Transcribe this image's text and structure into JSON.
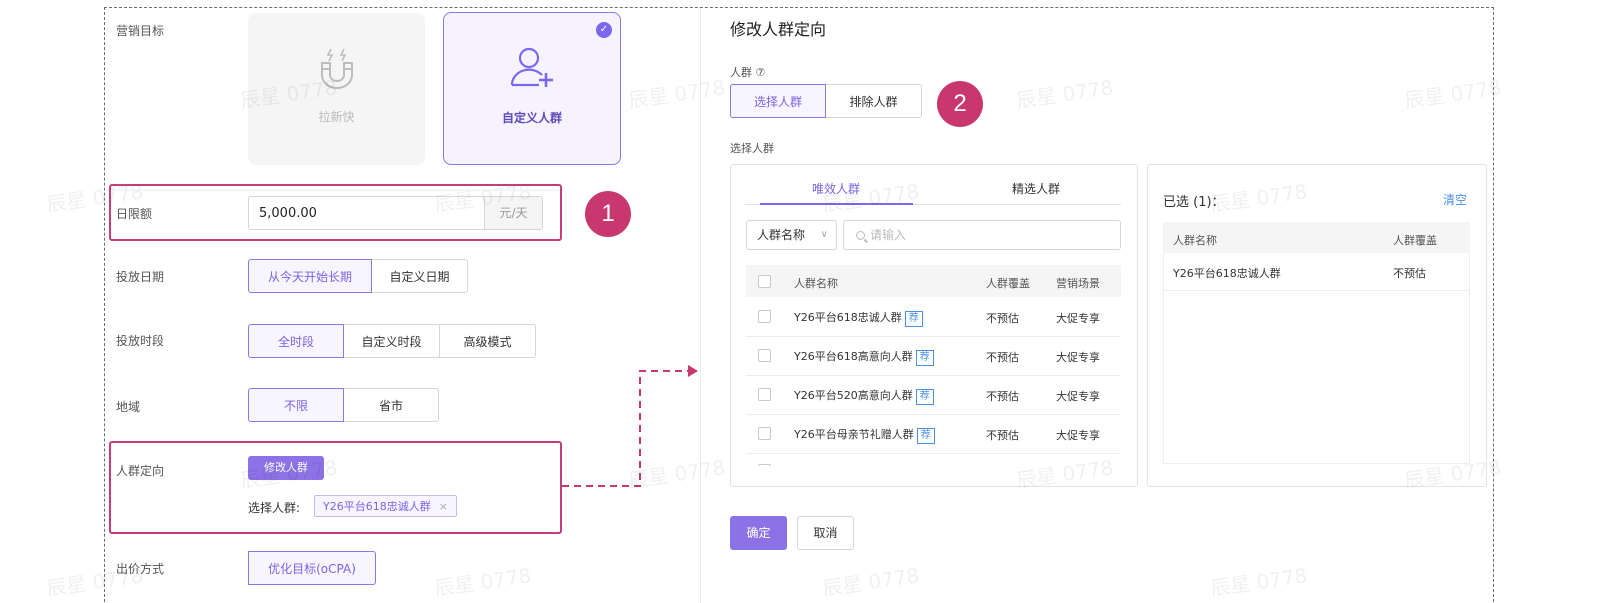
{
  "left_form": {
    "goal_label": "营销目标",
    "goal_cards": [
      {
        "label": "拉新快",
        "icon": "magnet-icon",
        "selected": false
      },
      {
        "label": "自定义人群",
        "icon": "add-user-icon",
        "selected": true
      }
    ],
    "budget_label": "日限额",
    "budget_value": "5,000.00",
    "budget_suffix": "元/天",
    "date_label": "投放日期",
    "date_options": [
      "从今天开始长期",
      "自定义日期"
    ],
    "time_label": "投放时段",
    "time_options": [
      "全时段",
      "自定义时段",
      "高级模式"
    ],
    "region_label": "地域",
    "region_options": [
      "不限",
      "省市"
    ],
    "audience_label": "人群定向",
    "modify_audience_btn": "修改人群",
    "selected_audience_prefix": "选择人群:",
    "selected_audience_tag": "Y26平台618忠诚人群",
    "bid_label": "出价方式",
    "bid_option": "优化目标(oCPA)"
  },
  "annotations": {
    "step1": "1",
    "step2": "2",
    "accent": "#c8386f"
  },
  "right_panel": {
    "title": "修改人群定向",
    "audience_label": "人群 ⑦",
    "mode_options": [
      "选择人群",
      "排除人群"
    ],
    "select_section_label": "选择人群",
    "tabs": [
      "唯效人群",
      "精选人群"
    ],
    "filter_select": "人群名称",
    "search_placeholder": "请输入",
    "columns": [
      "人群名称",
      "人群覆盖",
      "营销场景"
    ],
    "rows": [
      {
        "name": "Y26平台618忠诚人群",
        "badge": "荐",
        "coverage": "不预估",
        "scene": "大促专享"
      },
      {
        "name": "Y26平台618高意向人群",
        "badge": "荐",
        "coverage": "不预估",
        "scene": "大促专享"
      },
      {
        "name": "Y26平台520高意向人群",
        "badge": "荐",
        "coverage": "不预估",
        "scene": "大促专享"
      },
      {
        "name": "Y26平台母亲节礼赠人群",
        "badge": "荐",
        "coverage": "不预估",
        "scene": "大促专享"
      }
    ],
    "selected_title": "已选 (1)：",
    "clear_label": "清空",
    "selected_columns": [
      "人群名称",
      "人群覆盖"
    ],
    "selected_rows": [
      {
        "name": "Y26平台618忠诚人群",
        "coverage": "不预估"
      }
    ],
    "confirm_label": "确定",
    "cancel_label": "取消"
  },
  "watermark": "辰星 0778",
  "colors": {
    "primary": "#7b68ee",
    "highlight_border": "#c73c7d",
    "link": "#4a90e2"
  }
}
